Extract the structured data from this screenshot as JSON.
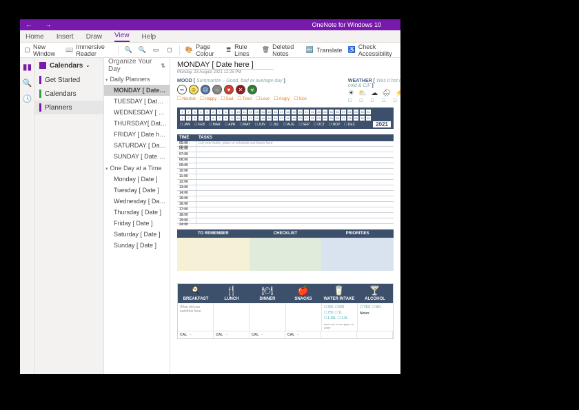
{
  "title": "OneNote for Windows 10",
  "menu": [
    "Home",
    "Insert",
    "Draw",
    "View",
    "Help"
  ],
  "menu_active": 3,
  "ribbon": {
    "new_window": "New Window",
    "immersive": "Immersive Reader",
    "page_colour": "Page Colour",
    "rule_lines": "Rule Lines",
    "deleted": "Deleted Notes",
    "translate": "Translate",
    "accessibility": "Check Accessibility"
  },
  "notebook": "Calendars",
  "sections": [
    {
      "label": "Get Started",
      "color": "#7719aa"
    },
    {
      "label": "Calendars",
      "color": "#2aa34a"
    },
    {
      "label": "Planners",
      "color": "#7719aa",
      "selected": true
    }
  ],
  "section_panel_title": "Organize Your Day",
  "groups": [
    {
      "title": "Daily Planners",
      "pages": [
        "MONDAY [ Date her...",
        "TUESDAY [ Date her...",
        "WEDNESDAY [ Date...",
        "THURSDAY[ Date he...",
        "FRIDAY [ Date here ]",
        "SATURDAY [ Date h...",
        "SUNDAY [ Date here ]"
      ],
      "selected": 0
    },
    {
      "title": "One Day at a Time",
      "pages": [
        "Monday [ Date ]",
        "Tuesday [ Date ]",
        "Wednesday [ Date ]",
        "Thursday [ Date ]",
        "Friday [ Date ]",
        "Saturday [ Date ]",
        "Sunday [ Date ]"
      ]
    }
  ],
  "page": {
    "title": "MONDAY [ Date here ]",
    "subtitle": "Monday, 23 August 2021    12:25 PM",
    "mood_label": "MOOD [",
    "mood_hint": " Summarize – Good, bad or average day ",
    "mood_close": "]",
    "weather_label": "WEATHER [",
    "weather_hint": " Was it hot or cold & C/F ",
    "weather_close": "]",
    "mood_opts": [
      "Neutral",
      "Happy",
      "Sad",
      "Tired",
      "Love",
      "Angry",
      "Sick"
    ],
    "months_list": [
      "JAN",
      "FEB",
      "MAR",
      "APR",
      "MAY",
      "JUN",
      "JUL",
      "AUG",
      "SEP",
      "OCT",
      "NOV",
      "DEC"
    ],
    "year": "2021",
    "sched": {
      "head_time": "TIME",
      "head_task": "TASKS",
      "hint": "List your tasks, plans or schedule out hours here",
      "times": [
        "05:00 - 06:00",
        "06:00",
        "07:00",
        "08:00",
        "09:00",
        "10:00",
        "11:00",
        "12:00",
        "13:00",
        "14:00",
        "15:00",
        "16:00",
        "17:00",
        "18:00",
        "19:00 - 24:00"
      ]
    },
    "tri": [
      "TO REMEMBER",
      "CHECKLIST",
      "PRIORITIES"
    ],
    "meals": {
      "cols": [
        "BREAKFAST",
        "LUNCH",
        "DINNER",
        "SNACKS",
        "WATER INTAKE",
        "ALCOHOL"
      ],
      "hint": "What did you eat/drink here",
      "water_opts": [
        "250",
        "500",
        "750",
        "1L",
        "1.25L",
        "1.5L"
      ],
      "water_note": "each box is one glass of water",
      "alc": [
        "YES",
        "NO"
      ],
      "notes": "Notes",
      "cal": "CAL",
      "dash": "–"
    }
  }
}
